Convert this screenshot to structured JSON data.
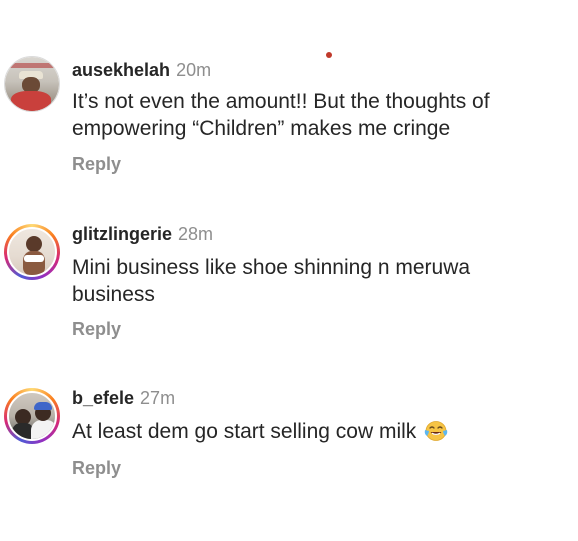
{
  "comments": [
    {
      "username": "ausekhelah",
      "time": "20m",
      "text_line1": "It’s not even the amount!! But the thoughts of",
      "text_line2": "empowering “Children” makes me cringe",
      "reply_label": "Reply"
    },
    {
      "username": "glitzlingerie",
      "time": "28m",
      "text_line1": "Mini business like shoe shinning n meruwa",
      "text_line2": "business",
      "reply_label": "Reply"
    },
    {
      "username": "b_efele",
      "time": "27m",
      "text_line1": "At least dem go start selling cow milk",
      "emoji": "face-with-tears-of-joy-icon",
      "reply_label": "Reply"
    }
  ],
  "colors": {
    "text": "#262626",
    "muted": "#8e8e8e",
    "accent_dot": "#c0392b"
  }
}
